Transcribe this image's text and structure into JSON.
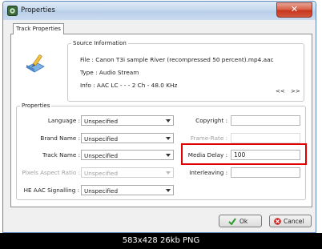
{
  "window": {
    "title": "Properties",
    "close_glyph": "✕"
  },
  "tabs": [
    {
      "label": "Track Properties"
    }
  ],
  "source_info": {
    "group_label": "Source Information",
    "file": "File : Canon T3i sample River (recompressed 50 percent).mp4.aac",
    "type": "Type : Audio Stream",
    "info": "Info : AAC LC -  -  - 2 Ch - 48.0 KHz",
    "prev_label": "<<",
    "next_label": ">>"
  },
  "properties": {
    "group_label": "Properties",
    "language": {
      "label": "Language :",
      "value": "Unspecified"
    },
    "brand_name": {
      "label": "Brand Name :",
      "value": "Unspecified"
    },
    "track_name": {
      "label": "Track Name :",
      "value": "Unspecified"
    },
    "pixels_aspect_ratio": {
      "label": "Pixels Aspect Ratio :",
      "value": "Unspecified"
    },
    "he_aac_signalling": {
      "label": "HE AAC Signalling :",
      "value": "Unspecified"
    },
    "copyright": {
      "label": "Copyright :",
      "value": ""
    },
    "frame_rate": {
      "label": "Frame-Rate :",
      "value": ""
    },
    "media_delay": {
      "label": "Media Delay :",
      "value": "100"
    },
    "interleaving": {
      "label": "Interleaving :",
      "value": ""
    }
  },
  "buttons": {
    "ok": "Ok",
    "cancel": "Cancel"
  },
  "status_caption": "583x428 26kb PNG",
  "colors": {
    "highlight_border": "#e00000",
    "ok_check": "#2e9b2e",
    "cancel_x": "#cc2020"
  },
  "icons": [
    "app-icon",
    "close-icon",
    "source-info-icon",
    "check-icon",
    "cancel-icon"
  ]
}
